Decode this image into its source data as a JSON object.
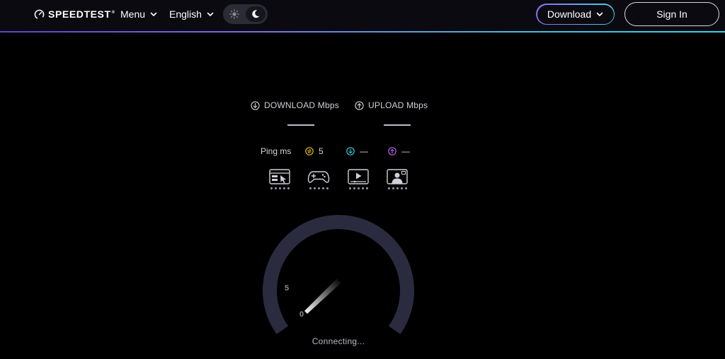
{
  "header": {
    "logo_text": "SPEEDTEST",
    "logo_tm": "®",
    "menu_label": "Menu",
    "language_label": "English",
    "download_label": "Download",
    "signin_label": "Sign In"
  },
  "metrics": {
    "download_label": "DOWNLOAD Mbps",
    "upload_label": "UPLOAD Mbps"
  },
  "ping": {
    "label": "Ping ms",
    "idle_value": "5",
    "download_value": "—",
    "upload_value": "—"
  },
  "gauge": {
    "tick_0": "0",
    "tick_5": "5",
    "status": "Connecting..."
  },
  "colors": {
    "idle_ping": "#e6b91e",
    "download_ping": "#3cc6d8",
    "upload_ping": "#b466ee",
    "gauge_track": "#2b2b40"
  }
}
